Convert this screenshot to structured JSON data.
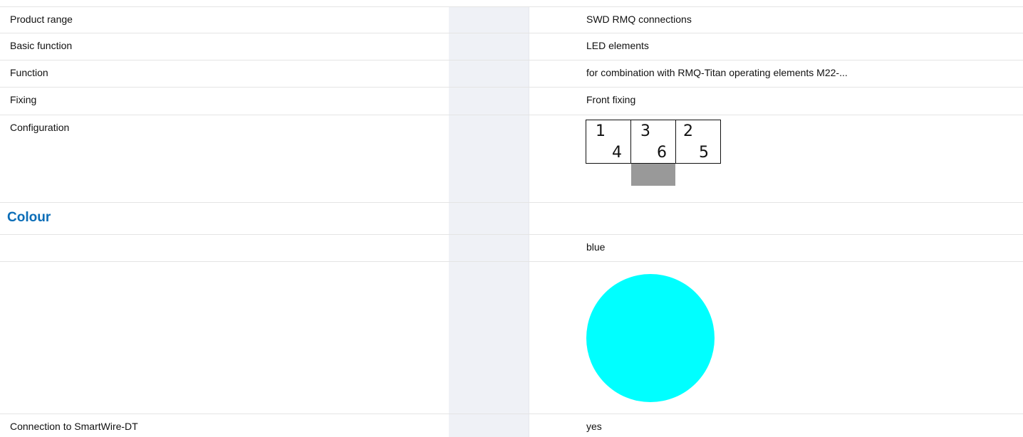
{
  "rows": {
    "product_range": {
      "label": "Product range",
      "value": "SWD RMQ connections"
    },
    "basic_function": {
      "label": "Basic function",
      "value": "LED elements"
    },
    "function": {
      "label": "Function",
      "value": "for combination with RMQ-Titan operating elements M22-..."
    },
    "fixing": {
      "label": "Fixing",
      "value": "Front fixing"
    },
    "configuration": {
      "label": "Configuration",
      "diagram": {
        "cells": [
          {
            "top": "1",
            "bottom": "4"
          },
          {
            "top": "3",
            "bottom": "6"
          },
          {
            "top": "2",
            "bottom": "5"
          }
        ]
      }
    }
  },
  "colour_section": {
    "title": "Colour",
    "colour_name": "blue",
    "swatch_color": "#00ffff"
  },
  "connection": {
    "label": "Connection to SmartWire-DT",
    "value": "yes"
  },
  "colors": {
    "heading_blue": "#0b6db7",
    "column_shade": "#eff1f6",
    "diagram_tab": "#999999"
  }
}
